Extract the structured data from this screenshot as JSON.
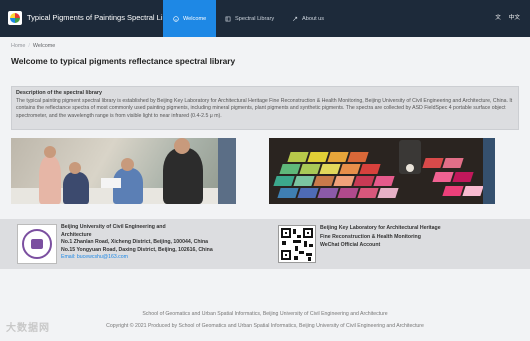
{
  "header": {
    "site_title": "Typical Pigments of Paintings Spectral Library",
    "tabs": [
      {
        "label": "Welcome",
        "icon": "smile-icon",
        "active": true
      },
      {
        "label": "Spectral Library",
        "icon": "book-icon",
        "active": false
      },
      {
        "label": "About us",
        "icon": "rocket-icon",
        "active": false
      }
    ],
    "lang_icon": "translate-icon",
    "lang_label": "中文"
  },
  "breadcrumb": {
    "home": "Home",
    "separator": "/",
    "current": "Welcome"
  },
  "page_title": "Welcome to typical pigments reflectance spectral library",
  "description": {
    "title": "Description of the spectral library",
    "lines": [
      "The typical painting pigment spectral library is established by Beijing Key Laboratory for Architectural Heritage Fine Reconstruction & Health Monitoring, Beijing University of Civil",
      "Engineering and Architecture, China. It contains the reflectance spectra of most commonly used painting pigments, including mineral pigments, plant pigments and synthetic pigments. The",
      "spectra are collected by ASD FieldSpec 4 portable surface object spectrometer, and the wavelength range is from visible light to near infrared (0.4-2.5 μ m)."
    ]
  },
  "contact": {
    "university_lines": [
      "Beijing University of Civil Engineering and",
      "Architecture",
      "No.1 Zhanlan Road, Xicheng District, Beijing, 100044, China",
      "No.15 Yongyuan Road, Daxing District, Beijing, 102616, China"
    ],
    "email": "Email: bucewcshu@163.com",
    "wechat_lines": [
      "Beijing Key Laboratory for Architectural Heritage",
      "Fine Reconstruction & Health Monitoring",
      "WeChat Official Account"
    ]
  },
  "footer": {
    "line1": "School of Geomatics and Urban Spatial Informatics, Beijing University of Civil Engineering and Architecture",
    "line2": "Copyright © 2021 Produced by School of Geomatics and Urban Spatial Informatics, Beijing University of Civil Engineering and Architecture"
  },
  "watermark": "大数据网",
  "colors": {
    "nav_bg": "#1d2a3a",
    "accent": "#1e88e5",
    "band_bg": "#dcdde0"
  }
}
